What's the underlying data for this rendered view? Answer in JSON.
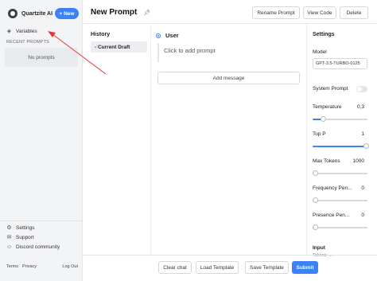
{
  "brand": {
    "name": "Quartzite AI",
    "new_button": "+ New"
  },
  "sidebar": {
    "variables_label": "Variables",
    "recent_label": "RECENT PROMPTS",
    "no_prompts": "No prompts",
    "links": {
      "settings": "Settings",
      "support": "Support",
      "discord": "Discord community"
    },
    "footer": {
      "terms": "Terms",
      "privacy": "Privacy",
      "logout": "Log Out"
    }
  },
  "header": {
    "title": "New Prompt",
    "rename": "Rename Prompt",
    "view_code": "View Code",
    "delete": "Delete"
  },
  "history": {
    "title": "History",
    "current_draft": "- Current Draft"
  },
  "editor": {
    "role": "User",
    "placeholder": "Click to add prompt",
    "add_message": "Add message"
  },
  "settings": {
    "title": "Settings",
    "model_label": "Model",
    "model_value": "GPT-3.5-TURBO-0125",
    "system_prompt_label": "System Prompt",
    "system_prompt_enabled": false,
    "params": [
      {
        "label": "Temperature",
        "value": "0,3",
        "level": 0.15
      },
      {
        "label": "Top P",
        "value": "1",
        "level": 1.0
      },
      {
        "label": "Max Tokens",
        "value": "1000",
        "level": 0.0
      },
      {
        "label": "Frequency Pen...",
        "value": "0",
        "level": 0.0
      },
      {
        "label": "Presence Pen...",
        "value": "0",
        "level": 0.0
      }
    ],
    "input_title": "Input",
    "tokens_label": "Tokens: ..."
  },
  "footer": {
    "clear": "Clear chat",
    "load": "Load Template",
    "save": "Save Template",
    "submit": "Submit"
  },
  "colors": {
    "accent": "#3b82f6",
    "annotation_arrow": "#e53935"
  }
}
